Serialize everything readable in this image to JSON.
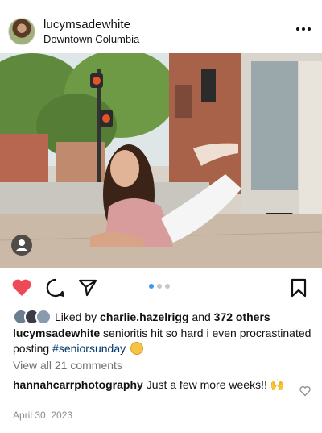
{
  "post": {
    "username": "lucymsadewhite",
    "location": "Downtown Columbia"
  },
  "icons": {
    "more": "more-horizontal-icon",
    "like": "heart-filled-icon",
    "comment": "comment-icon",
    "share": "share-icon",
    "save": "bookmark-icon",
    "tag": "person-tag-icon",
    "comment_like": "heart-outline-icon"
  },
  "colors": {
    "like_red": "#ed4956",
    "hashtag": "#00376b",
    "carousel_active": "#3897f0",
    "muted": "#8e8e8e"
  },
  "carousel": {
    "count": 3,
    "active_index": 1
  },
  "likes": {
    "prefix": "Liked by",
    "user": "charlie.hazelrigg",
    "middle": "and",
    "others": "372 others"
  },
  "caption": {
    "username": "lucymsadewhite",
    "text": "senioritis hit so hard i even procrastinated posting",
    "hashtag": "#seniorsunday"
  },
  "comments": {
    "view_all": "View all 21 comments",
    "top": {
      "username": "hannahcarrphotography",
      "text": "Just a few more weeks!! 🙌"
    }
  },
  "date": "April 30, 2023"
}
